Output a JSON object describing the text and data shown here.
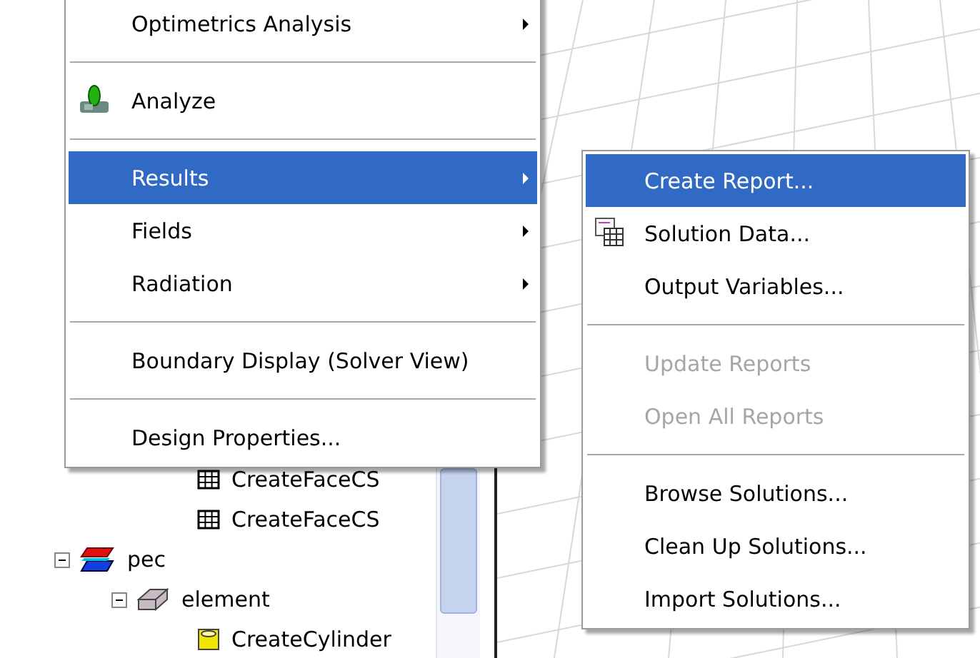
{
  "tree": {
    "items": [
      {
        "children": [
          {
            "children": [
              {
                "label": "CreateFaceCS",
                "kind": "coordinate-system"
              },
              {
                "label": "CreateFaceCS",
                "kind": "coordinate-system"
              }
            ]
          }
        ]
      },
      {
        "label": "pec",
        "kind": "material",
        "expanded": true,
        "children": [
          {
            "label": "element",
            "kind": "object",
            "expanded": true,
            "children": [
              {
                "label": "CreateCylinder",
                "kind": "operation"
              }
            ]
          }
        ]
      }
    ]
  },
  "context_menu": {
    "items": [
      {
        "kind": "item",
        "label": "Optimetrics Analysis",
        "submenu": true,
        "selected": false,
        "disabled": false,
        "has_icon": false
      },
      {
        "kind": "separator"
      },
      {
        "kind": "item",
        "label": "Analyze",
        "submenu": false,
        "selected": false,
        "disabled": false,
        "has_icon": true
      },
      {
        "kind": "separator"
      },
      {
        "kind": "item",
        "label": "Results",
        "submenu": true,
        "selected": true,
        "disabled": false,
        "has_icon": false
      },
      {
        "kind": "item",
        "label": "Fields",
        "submenu": true,
        "selected": false,
        "disabled": false,
        "has_icon": false
      },
      {
        "kind": "item",
        "label": "Radiation",
        "submenu": true,
        "selected": false,
        "disabled": false,
        "has_icon": false
      },
      {
        "kind": "separator"
      },
      {
        "kind": "item",
        "label": "Boundary Display (Solver View)",
        "submenu": false,
        "selected": false,
        "disabled": false,
        "has_icon": false
      },
      {
        "kind": "separator"
      },
      {
        "kind": "item",
        "label": "Design Properties...",
        "submenu": false,
        "selected": false,
        "disabled": false,
        "has_icon": false
      }
    ]
  },
  "results_submenu": {
    "items": [
      {
        "kind": "item",
        "label": "Create Report...",
        "submenu": false,
        "selected": true,
        "disabled": false,
        "has_icon": false
      },
      {
        "kind": "item",
        "label": "Solution Data...",
        "submenu": false,
        "selected": false,
        "disabled": false,
        "has_icon": true
      },
      {
        "kind": "item",
        "label": "Output Variables...",
        "submenu": false,
        "selected": false,
        "disabled": false,
        "has_icon": false
      },
      {
        "kind": "separator"
      },
      {
        "kind": "item",
        "label": "Update Reports",
        "submenu": false,
        "selected": false,
        "disabled": true,
        "has_icon": false
      },
      {
        "kind": "item",
        "label": "Open All Reports",
        "submenu": false,
        "selected": false,
        "disabled": true,
        "has_icon": false
      },
      {
        "kind": "separator"
      },
      {
        "kind": "item",
        "label": "Browse Solutions...",
        "submenu": false,
        "selected": false,
        "disabled": false,
        "has_icon": false
      },
      {
        "kind": "item",
        "label": "Clean Up Solutions...",
        "submenu": false,
        "selected": false,
        "disabled": false,
        "has_icon": false
      },
      {
        "kind": "item",
        "label": "Import Solutions...",
        "submenu": false,
        "selected": false,
        "disabled": false,
        "has_icon": false
      }
    ]
  }
}
